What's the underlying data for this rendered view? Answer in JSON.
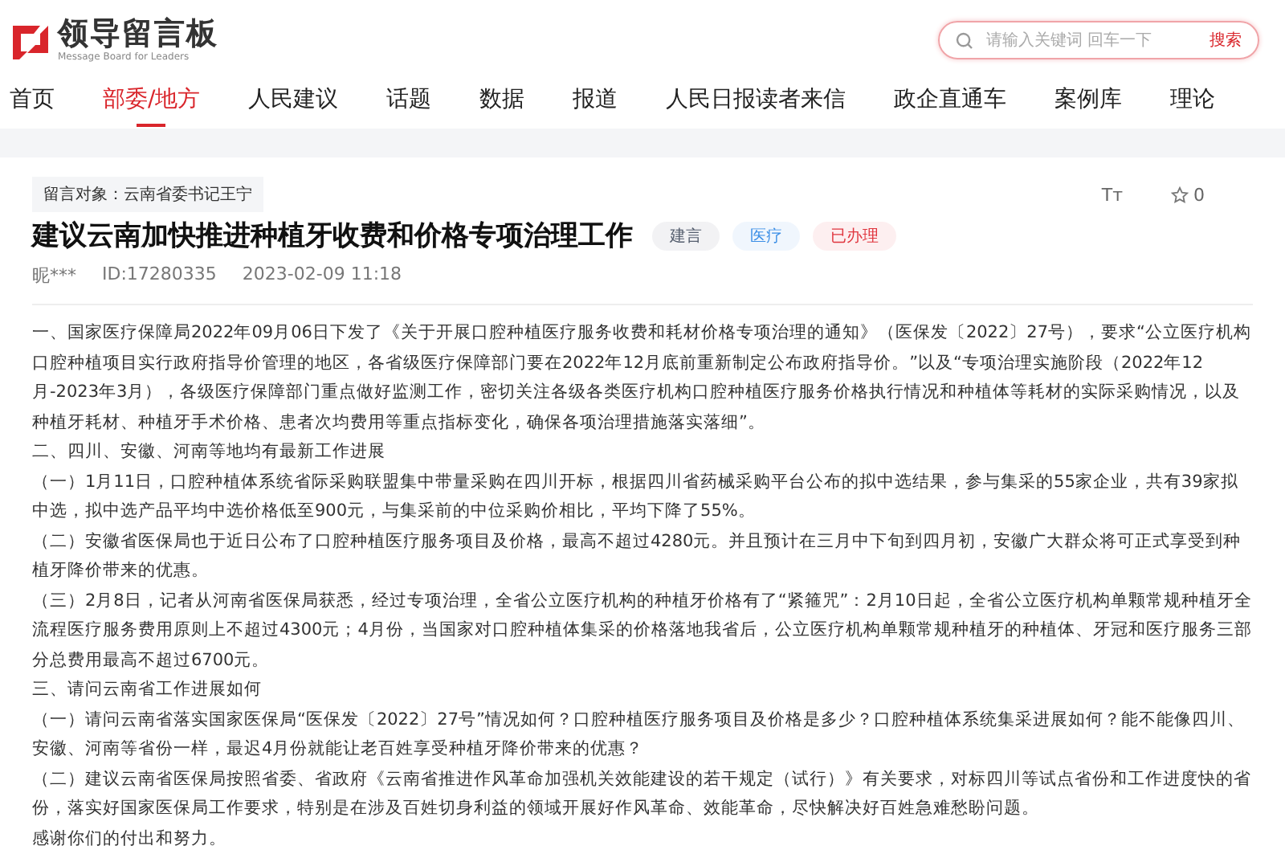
{
  "header": {
    "logo_title": "领导留言板",
    "logo_subtitle": "Message Board for Leaders",
    "search": {
      "placeholder": "请输入关键词 回车一下",
      "button": "搜索"
    }
  },
  "nav": [
    {
      "label": "首页",
      "selected": false
    },
    {
      "label": "部委/地方",
      "selected": true
    },
    {
      "label": "人民建议",
      "selected": false
    },
    {
      "label": "话题",
      "selected": false
    },
    {
      "label": "数据",
      "selected": false
    },
    {
      "label": "报道",
      "selected": false
    },
    {
      "label": "人民日报读者来信",
      "selected": false
    },
    {
      "label": "政企直通车",
      "selected": false
    },
    {
      "label": "案例库",
      "selected": false
    },
    {
      "label": "理论",
      "selected": false
    }
  ],
  "message": {
    "target": "留言对象：云南省委书记王宁",
    "font_size_toggle": "Tт",
    "star_count": "0",
    "title": "建议云南加快推进种植牙收费和价格专项治理工作",
    "tags": [
      {
        "label": "建言",
        "color": "#555e6e"
      },
      {
        "label": "医疗",
        "color": "#3a8ee6"
      },
      {
        "label": "已办理",
        "color": "#e0363f"
      }
    ],
    "author": "昵***",
    "id": "ID:17280335",
    "time": "2023-02-09 11:18",
    "paragraphs": [
      "一、国家医疗保障局2022年09月06日下发了《关于开展口腔种植医疗服务收费和耗材价格专项治理的通知》（医保发〔2022〕27号），要求“公立医疗机构口腔种植项目实行政府指导价管理的地区，各省级医疗保障部门要在2022年12月底前重新制定公布政府指导价。”以及“专项治理实施阶段（2022年12月-2023年3月），各级医疗保障部门重点做好监测工作，密切关注各级各类医疗机构口腔种植医疗服务价格执行情况和种植体等耗材的实际采购情况，以及种植牙耗材、种植牙手术价格、患者次均费用等重点指标变化，确保各项治理措施落实落细”。",
      "二、四川、安徽、河南等地均有最新工作进展",
      "（一）1月11日，口腔种植体系统省际采购联盟集中带量采购在四川开标，根据四川省药械采购平台公布的拟中选结果，参与集采的55家企业，共有39家拟中选，拟中选产品平均中选价格低至900元，与集采前的中位采购价相比，平均下降了55%。",
      "（二）安徽省医保局也于近日公布了口腔种植医疗服务项目及价格，最高不超过4280元。并且预计在三月中下旬到四月初，安徽广大群众将可正式享受到种植牙降价带来的优惠。",
      "（三）2月8日，记者从河南省医保局获悉，经过专项治理，全省公立医疗机构的种植牙价格有了“紧箍咒”：2月10日起，全省公立医疗机构单颗常规种植牙全流程医疗服务费用原则上不超过4300元；4月份，当国家对口腔种植体集采的价格落地我省后，公立医疗机构单颗常规种植牙的种植体、牙冠和医疗服务三部分总费用最高不超过6700元。",
      "三、请问云南省工作进展如何",
      "（一）请问云南省落实国家医保局“医保发〔2022〕27号”情况如何？口腔种植医疗服务项目及价格是多少？口腔种植体系统集采进展如何？能不能像四川、安徽、河南等省份一样，最迟4月份就能让老百姓享受种植牙降价带来的优惠？",
      "（二）建议云南省医保局按照省委、省政府《云南省推进作风革命加强机关效能建设的若干规定（试行）》有关要求，对标四川等试点省份和工作进度快的省份，落实好国家医保局工作要求，特别是在涉及百姓切身利益的领域开展好作风革命、效能革命，尽快解决好百姓急难愁盼问题。",
      "感谢你们的付出和努力。"
    ]
  }
}
